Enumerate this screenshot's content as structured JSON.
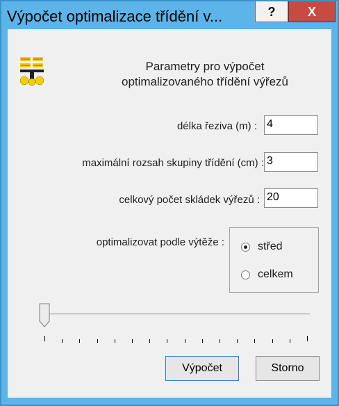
{
  "window": {
    "title": "Výpočet optimalizace třídění v...",
    "help_label": "?",
    "close_label": "X"
  },
  "header": {
    "line1": "Parametry  pro výpočet",
    "line2": "optimalizovaného třídění výřezů"
  },
  "fields": {
    "length_label": "délka řeziva (m) :",
    "length_value": "4",
    "range_label": "maximální rozsah skupiny třídění (cm) :",
    "range_value": "3",
    "count_label": "celkový počet skládek výřezů :",
    "count_value": "20"
  },
  "optimize": {
    "label": "optimalizovat podle výtěže :",
    "options": [
      {
        "label": "střed",
        "checked": true
      },
      {
        "label": "celkem",
        "checked": false
      }
    ]
  },
  "slider": {
    "value": 0,
    "tick_count": 16
  },
  "buttons": {
    "calculate": "Výpočet",
    "cancel": "Storno"
  },
  "colors": {
    "title_bar": "#5db4e8",
    "close_button": "#c84b41",
    "dialog_bg": "#f0f0f0",
    "logo_yellow": "#f2d000",
    "logo_red": "#c0392b"
  },
  "icons": {
    "logo": "sorting-logo-icon",
    "slider_thumb": "slider-thumb-icon"
  }
}
